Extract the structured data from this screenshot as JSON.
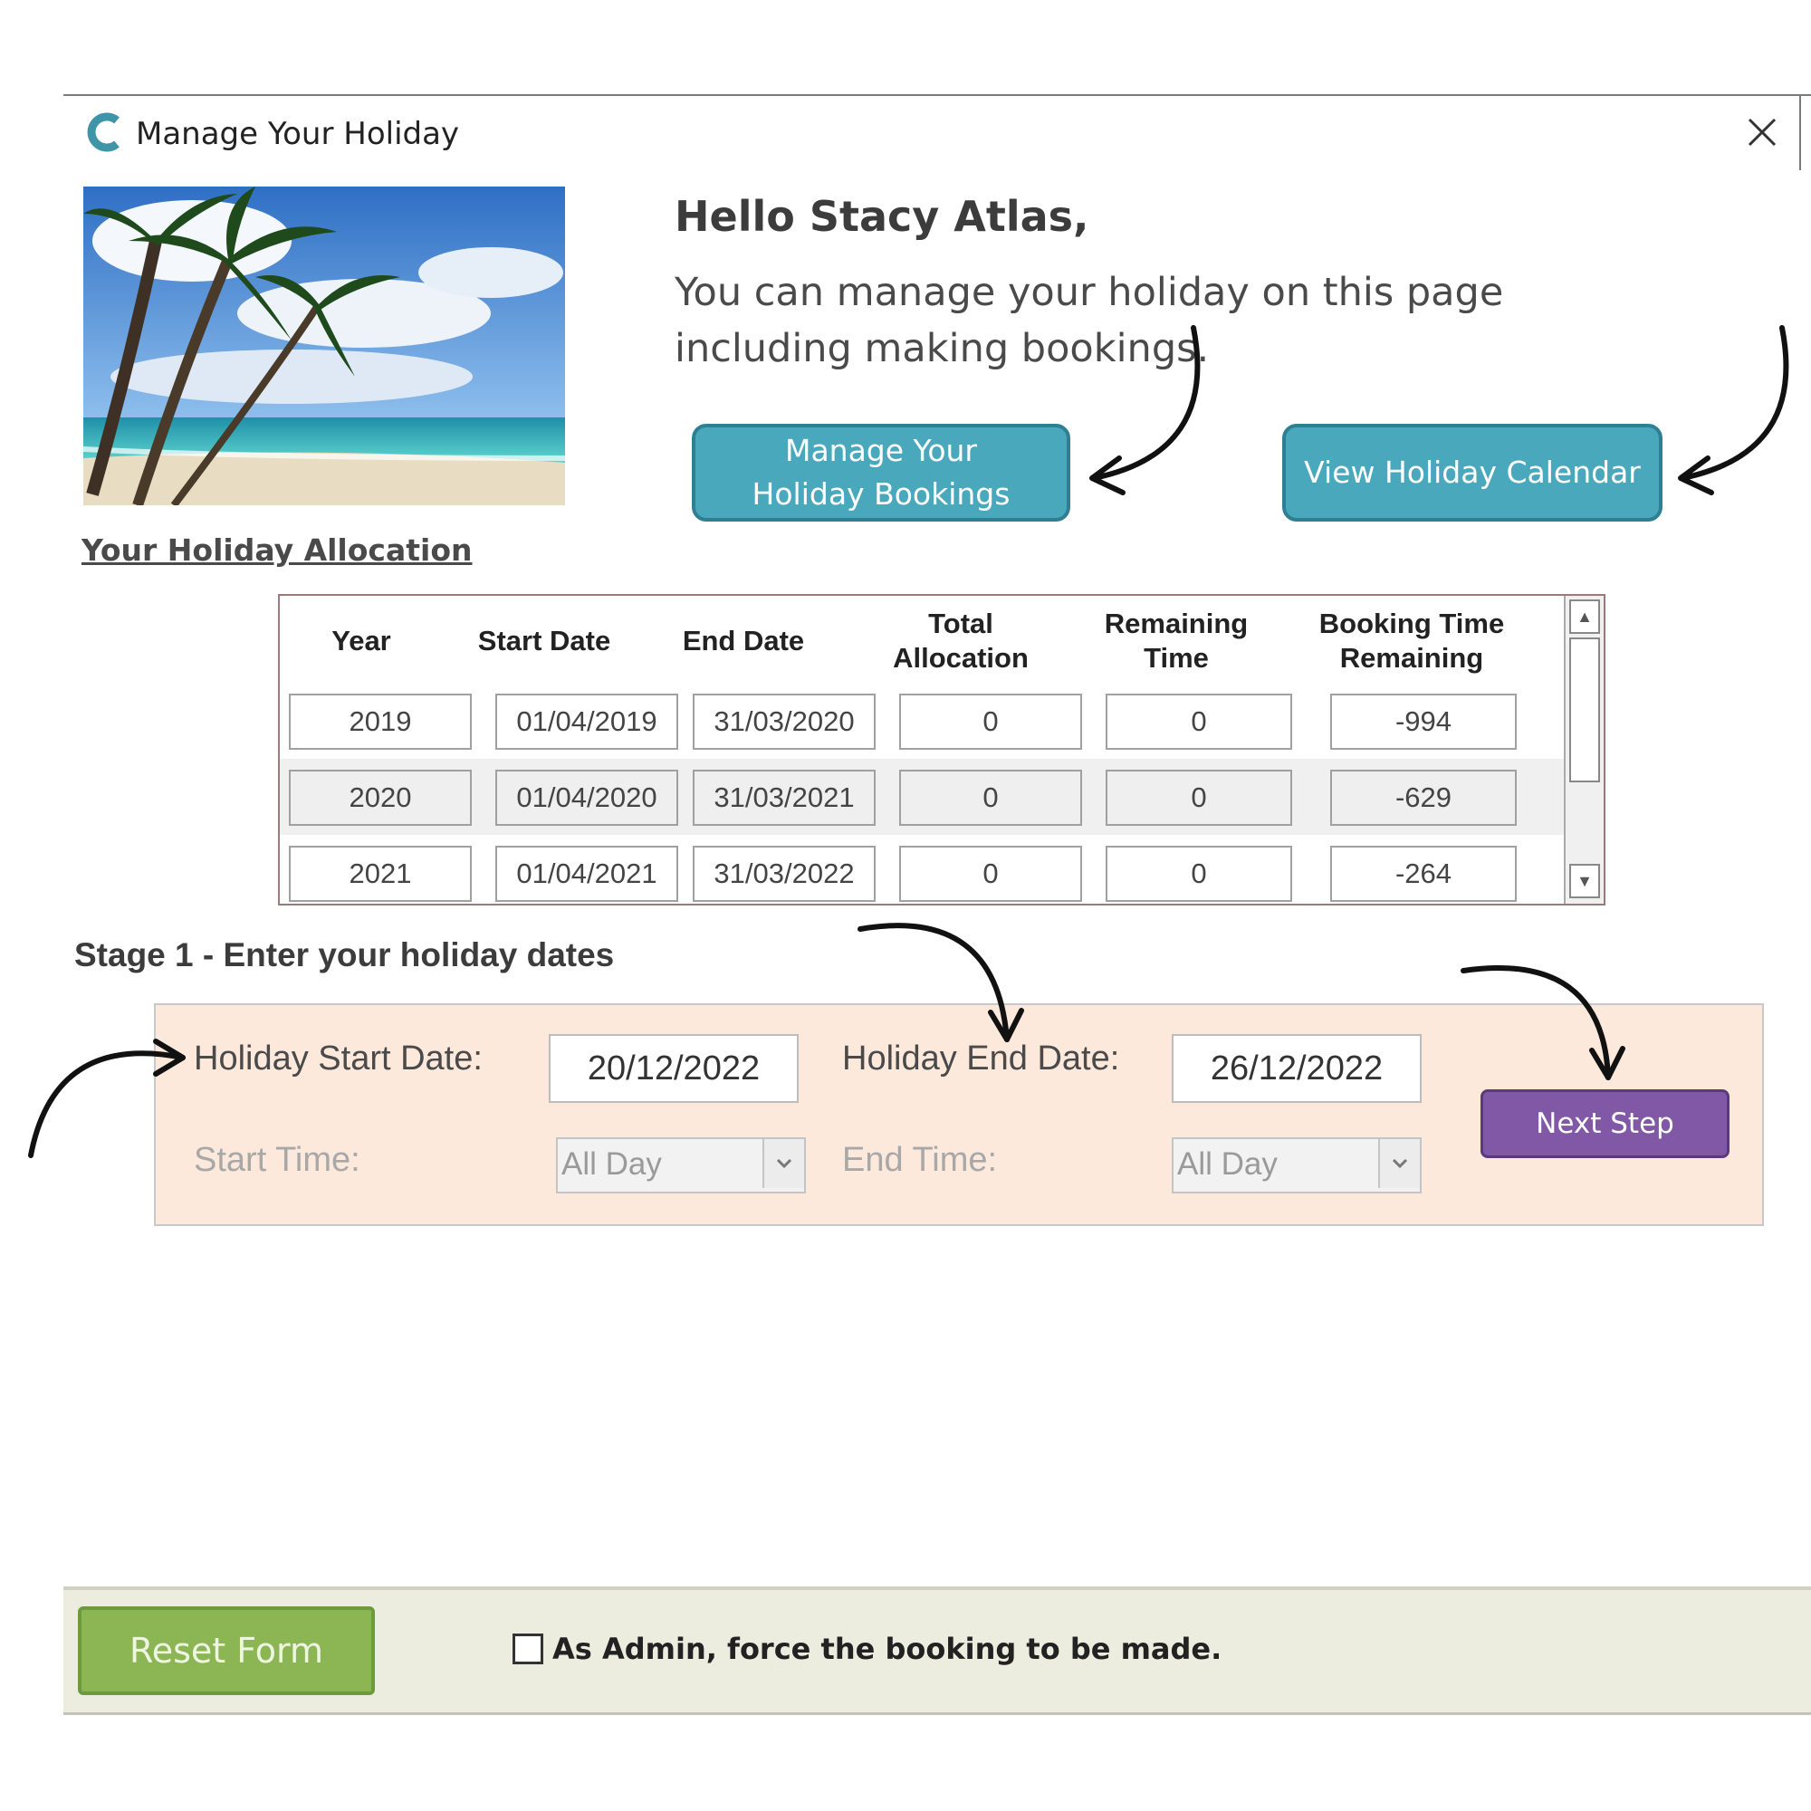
{
  "window": {
    "title": "Manage Your Holiday",
    "app_icon": "c-logo-icon",
    "close_icon": "close-icon"
  },
  "hero": {
    "greeting": "Hello Stacy Atlas,",
    "intro": "You can manage your holiday on this page including making bookings.",
    "manage_bookings_line1": "Manage Your",
    "manage_bookings_line2": "Holiday Bookings",
    "view_calendar": "View Holiday Calendar",
    "button_color": "#4aa8bd"
  },
  "allocation": {
    "link_label": "Your Holiday Allocation",
    "headers": [
      "Year",
      "Start Date",
      "End Date",
      "Total Allocation",
      "Remaining Time",
      "Booking Time Remaining"
    ],
    "rows": [
      [
        "2019",
        "01/04/2019",
        "31/03/2020",
        "0",
        "0",
        "-994"
      ],
      [
        "2020",
        "01/04/2020",
        "31/03/2021",
        "0",
        "0",
        "-629"
      ],
      [
        "2021",
        "01/04/2021",
        "31/03/2022",
        "0",
        "0",
        "-264"
      ]
    ]
  },
  "stage1": {
    "heading": "Stage 1 - Enter your holiday dates",
    "start_date_label": "Holiday Start Date:",
    "start_date_value": "20/12/2022",
    "end_date_label": "Holiday End Date:",
    "end_date_value": "26/12/2022",
    "start_time_label": "Start Time:",
    "start_time_value": "All Day",
    "end_time_label": "End Time:",
    "end_time_value": "All Day",
    "next_step": "Next Step",
    "panel_color": "#fde8dc",
    "next_color": "#8058a6"
  },
  "footer": {
    "reset_form": "Reset Form",
    "admin_force": "As Admin, force the booking to be made.",
    "admin_checked": false,
    "reset_color": "#8cb654"
  }
}
